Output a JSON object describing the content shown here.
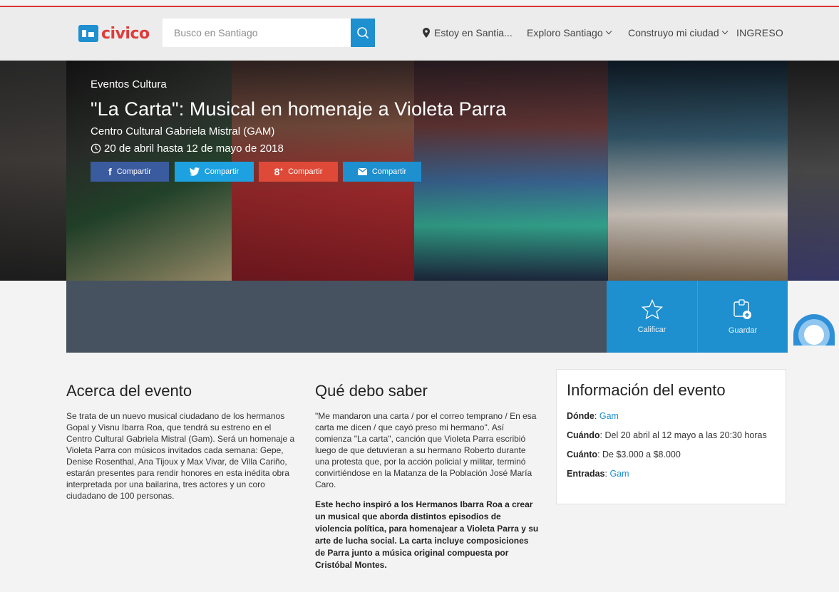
{
  "brand": {
    "name": "civico",
    "accent": "#1e8fcf",
    "logo_red": "#e03b3b"
  },
  "search": {
    "placeholder": "Busco en Santiago"
  },
  "nav": {
    "location": "Estoy en Santia...",
    "explore": "Exploro Santiago",
    "build": "Construyo mi ciudad",
    "login": "INGRESO"
  },
  "event": {
    "category": "Eventos Cultura",
    "title": "\"La Carta\": Musical en homenaje a Violeta Parra",
    "venue": "Centro Cultural Gabriela Mistral (GAM)",
    "dates": "20 de abril hasta 12 de mayo de 2018"
  },
  "share": {
    "facebook": "Compartir",
    "twitter": "Compartir",
    "googleplus": "Compartir",
    "email": "Compartir",
    "colors": {
      "facebook": "#3b5b9f",
      "twitter": "#1ea1e0",
      "googleplus": "#de4a37",
      "email": "#1e8fcf"
    }
  },
  "actions": {
    "rate": "Calificar",
    "save": "Guardar"
  },
  "about": {
    "heading": "Acerca del evento",
    "text": "Se trata de un nuevo musical ciudadano de los hermanos Gopal y Visnu Ibarra Roa, que tendrá su estreno en el Centro Cultural Gabriela Mistral (Gam). Será un homenaje a Violeta Parra con músicos invitados cada semana: Gepe, Denise Rosenthal, Ana Tijoux y Max Vivar, de Villa Cariño, estarán presentes para rendir honores en esta inédita obra interpretada por una bailarina, tres actores y un coro ciudadano de 100 personas."
  },
  "know": {
    "heading": "Qué debo saber",
    "text": "\"Me mandaron una carta / por el correo temprano / En esa carta me dicen / que cayó preso mi hermano\". Así comienza \"La carta\", canción que Violeta Parra escribió luego de que detuvieran a su hermano Roberto durante una protesta que, por la acción policial y militar, terminó convirtiéndose en la Matanza de la Población José María Caro.",
    "bold_text": "Este hecho inspiró a los Hermanos Ibarra Roa a crear un musical que aborda distintos episodios de violencia política, para homenajear a Violeta Parra y su arte de lucha social. La carta incluye composiciones de Parra junto a música original compuesta por Cristóbal Montes."
  },
  "info": {
    "heading": "Información del evento",
    "where_label": "Dónde",
    "where_value": "Gam",
    "when_label": "Cuándo",
    "when_value": "Del 20 abril al 12 mayo a las 20:30 horas",
    "price_label": "Cuánto",
    "price_value": "De $3.000 a $8.000",
    "tickets_label": "Entradas",
    "tickets_value": "Gam"
  }
}
